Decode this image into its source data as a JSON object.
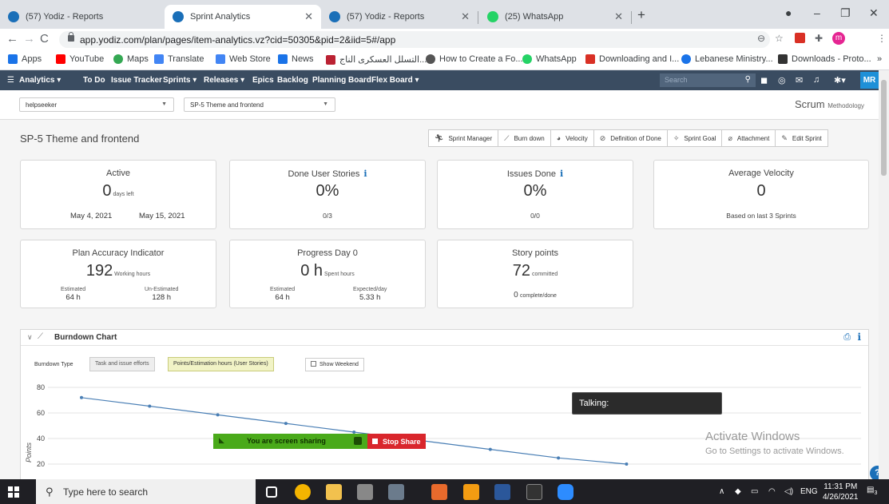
{
  "browser": {
    "tabs": [
      {
        "title": "(57) Yodiz - Reports",
        "active": false
      },
      {
        "title": "Sprint Analytics",
        "active": true
      },
      {
        "title": "(57) Yodiz - Reports",
        "active": false
      },
      {
        "title": "(25) WhatsApp",
        "active": false
      }
    ],
    "new_tab": "+",
    "url": "app.yodiz.com/plan/pages/item-analytics.vz?cid=50305&pid=2&iid=5#/app",
    "profile_initial": "m",
    "bookmarks": [
      "Apps",
      "YouTube",
      "Maps",
      "Translate",
      "Web Store",
      "News",
      "التسلل العسكرى الناج...",
      "How to Create a Fo...",
      "WhatsApp",
      "Downloading and I...",
      "Lebanese Ministry...",
      "Downloads - Proto..."
    ],
    "more_bookmarks": "»"
  },
  "app_nav": {
    "items": [
      "Analytics ▾",
      "To Do",
      "Issue Tracker",
      "Sprints ▾",
      "Releases ▾",
      "Epics",
      "Backlog",
      "Planning Board",
      "Flex Board ▾"
    ],
    "search_placeholder": "Search",
    "user_initials": "MR"
  },
  "subbar": {
    "project": "helpseeker",
    "sprint": "SP-5 Theme and frontend",
    "methodology": "Scrum",
    "methodology_suffix": "Methodology"
  },
  "page": {
    "title": "SP-5 Theme and frontend",
    "toolbar": [
      "Sprint Manager",
      "Burn down",
      "Velocity",
      "Definition of Done",
      "Sprint Goal",
      "Attachment",
      "Edit Sprint"
    ]
  },
  "cards": {
    "active": {
      "title": "Active",
      "value": "0",
      "unit": "days left",
      "start": "May 4, 2021",
      "end": "May 15, 2021"
    },
    "done_stories": {
      "title": "Done User Stories",
      "value": "0%",
      "sub": "0/3"
    },
    "issues_done": {
      "title": "Issues Done",
      "value": "0%",
      "sub": "0/0"
    },
    "avg_velocity": {
      "title": "Average Velocity",
      "value": "0",
      "sub": "Based on last 3 Sprints"
    },
    "plan_accuracy": {
      "title": "Plan Accuracy Indicator",
      "value": "192",
      "unit": "Working hours",
      "left_label": "Estimated",
      "left_value": "64 h",
      "right_label": "Un-Estimated",
      "right_value": "128 h"
    },
    "progress": {
      "title": "Progress Day 0",
      "value": "0 h",
      "unit": "Spent hours",
      "left_label": "Estimated",
      "left_value": "64 h",
      "right_label": "Expected/day",
      "right_value": "5.33 h"
    },
    "story_points": {
      "title": "Story points",
      "value": "72",
      "unit": "committed",
      "sub_value": "0",
      "sub_unit": "complete/done"
    }
  },
  "burndown": {
    "title": "Burndown Chart",
    "type_label": "Burndown Type",
    "options": [
      "Task and issue efforts",
      "Points/Estimation hours (User Stories)"
    ],
    "selected_option": 1,
    "weekend_label": "Show Weekend"
  },
  "chart_data": {
    "type": "line",
    "ylabel": "Points",
    "yticks": [
      20,
      40,
      60,
      80
    ],
    "ylim": [
      20,
      80
    ],
    "x": [
      1,
      2,
      3,
      4,
      5,
      6,
      7,
      8,
      9
    ],
    "series": [
      {
        "values": [
          72,
          65.3,
          58.5,
          51.8,
          45,
          38.3,
          31.5,
          24.8,
          20
        ]
      }
    ],
    "line_color": "#4a7fb5",
    "grid": true
  },
  "overlays": {
    "talking": "Talking:",
    "share_text": "You are screen sharing",
    "stop_share": "Stop Share",
    "activate_title": "Activate Windows",
    "activate_sub": "Go to Settings to activate Windows.",
    "help": "?"
  },
  "taskbar": {
    "search_placeholder": "Type here to search",
    "lang": "ENG",
    "time": "11:31 PM",
    "date": "4/26/2021",
    "notif_count": "3"
  }
}
